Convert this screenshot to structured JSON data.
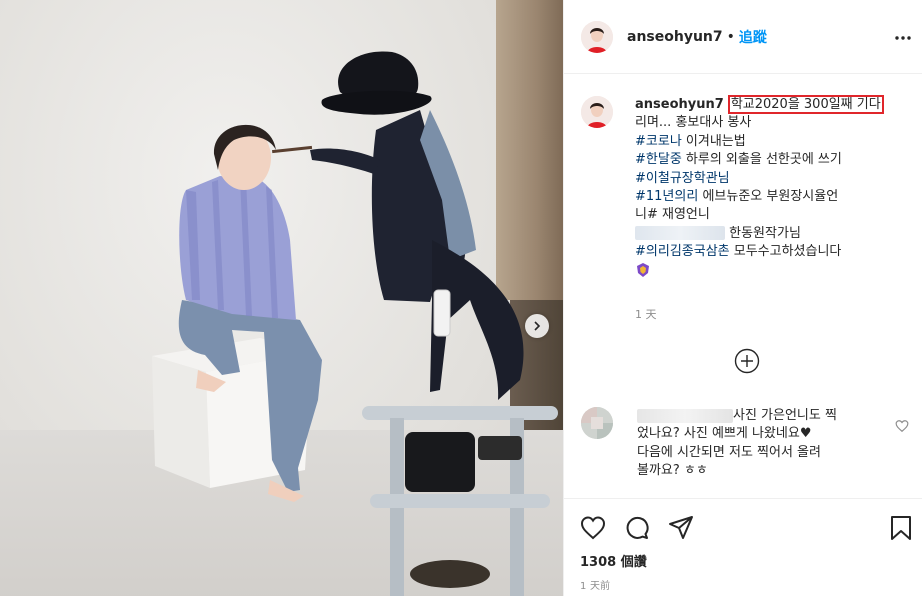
{
  "post": {
    "username": "anseohyun7",
    "follow_label": "追蹤",
    "dot": "•",
    "caption": {
      "highlight": "학교2020을 300일째 기다",
      "line1_rest": "리며... 홍보대사 봉사",
      "tag1": "#코로나",
      "tag1_rest": " 이겨내는법",
      "tag2": "#한달중",
      "tag2_rest": " 하루의 외출을 선한곳에 쓰기",
      "tag3": "#이철규장학관님",
      "tag4": "#11년의리",
      "tag4_rest": " 에브뉴준오 부원장시율언",
      "line_ni": "니# 재영언니",
      "line_hd": "한동원작가님",
      "tag5": "#의리김종국삼촌",
      "tag5_rest": " 모두수고하셨습니다"
    },
    "caption_time": "1 天",
    "comment": {
      "text_after_blur": "사진 가은언니도 찍",
      "line2": "었나요? 사진 예쁘게 나왔네요♥",
      "line3": "다음에 시간되면 저도 찍어서 올려",
      "line4": "볼까요? ㅎㅎ"
    },
    "likes": "1308 個讚",
    "posted_ago": "1 天前"
  },
  "colors": {
    "accent_blue": "#0095f6",
    "hashtag": "#00376b",
    "highlight_box": "#e0262b",
    "meta_gray": "#8e8e8e"
  },
  "icons": {
    "more": "ellipsis-icon",
    "next": "chevron-right-icon",
    "load_more": "plus-circle-icon",
    "like": "heart-icon",
    "comment": "comment-icon",
    "share": "paper-plane-icon",
    "save": "bookmark-icon"
  }
}
